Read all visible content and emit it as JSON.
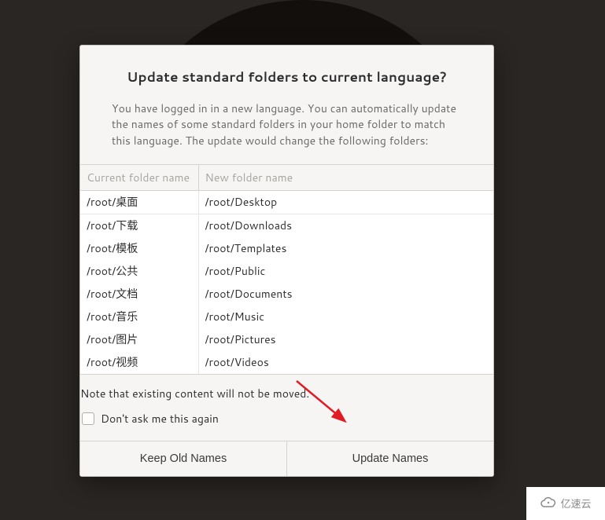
{
  "dialog": {
    "title": "Update standard folders to current language?",
    "description": "You have logged in in a new language. You can automatically update the names of some standard folders in your home folder to match this language. The update would change the following folders:",
    "columns": {
      "current": "Current folder name",
      "new": "New folder name"
    },
    "rows": [
      {
        "current": "/root/桌面",
        "new": "/root/Desktop"
      },
      {
        "current": "/root/下载",
        "new": "/root/Downloads"
      },
      {
        "current": "/root/模板",
        "new": "/root/Templates"
      },
      {
        "current": "/root/公共",
        "new": "/root/Public"
      },
      {
        "current": "/root/文档",
        "new": "/root/Documents"
      },
      {
        "current": "/root/音乐",
        "new": "/root/Music"
      },
      {
        "current": "/root/图片",
        "new": "/root/Pictures"
      },
      {
        "current": "/root/视频",
        "new": "/root/Videos"
      }
    ],
    "note": "Note that existing content will not be moved.",
    "dont_ask": "Don't ask me this again",
    "buttons": {
      "keep": "Keep Old Names",
      "update": "Update Names"
    }
  },
  "watermark": {
    "text": "亿速云"
  },
  "annotation": {
    "arrow_color": "#e01b24"
  }
}
